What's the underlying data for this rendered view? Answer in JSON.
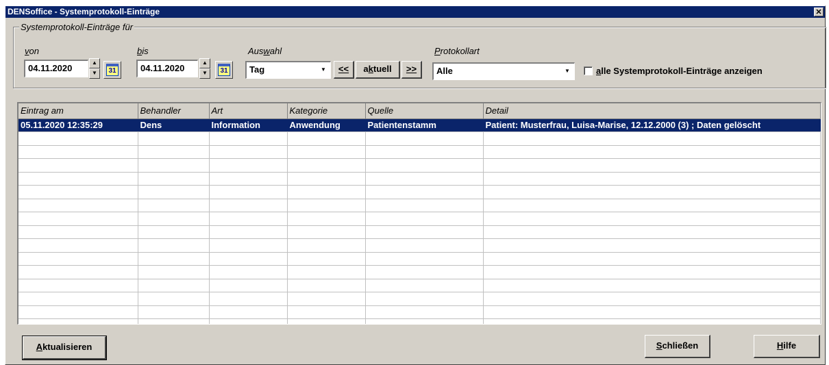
{
  "window": {
    "title": "DENSoffice - Systemprotokoll-Einträge",
    "close_label": "✕"
  },
  "filter": {
    "group_label": "Systemprotokoll-Einträge für",
    "von": {
      "label_pre": "",
      "label_mn": "v",
      "label_post": "on",
      "value": "04.11.2020"
    },
    "bis": {
      "label_pre": "",
      "label_mn": "b",
      "label_post": "is",
      "value": "04.11.2020"
    },
    "calendar_day": "31",
    "auswahl": {
      "label_pre": "Aus",
      "label_mn": "w",
      "label_post": "ahl",
      "value": "Tag"
    },
    "prev_button": "<<",
    "current_button_pre": "a",
    "current_button_mn": "k",
    "current_button_post": "tuell",
    "next_button": ">>",
    "protokollart": {
      "label_pre": "",
      "label_mn": "P",
      "label_post": "rotokollart",
      "value": "Alle"
    },
    "show_all": {
      "checked": false,
      "label_mn": "a",
      "label_post": "lle Systemprotokoll-Einträge anzeigen"
    }
  },
  "table": {
    "columns": [
      "Eintrag am",
      "Behandler",
      "Art",
      "Kategorie",
      "Quelle",
      "Detail"
    ],
    "rows": [
      [
        "05.11.2020 12:35:29",
        "Dens",
        "Information",
        "Anwendung",
        "Patientenstamm",
        "Patient: Musterfrau, Luisa-Marise, 12.12.2000 (3) ; Daten gelöscht"
      ]
    ]
  },
  "buttons": {
    "refresh_mn": "A",
    "refresh_post": "ktualisieren",
    "close_mn": "S",
    "close_post": "chließen",
    "help_mn": "H",
    "help_post": "ilfe"
  },
  "colors": {
    "titlebar": "#0a246a",
    "selection": "#0a246a",
    "dialog": "#d4d0c8"
  }
}
